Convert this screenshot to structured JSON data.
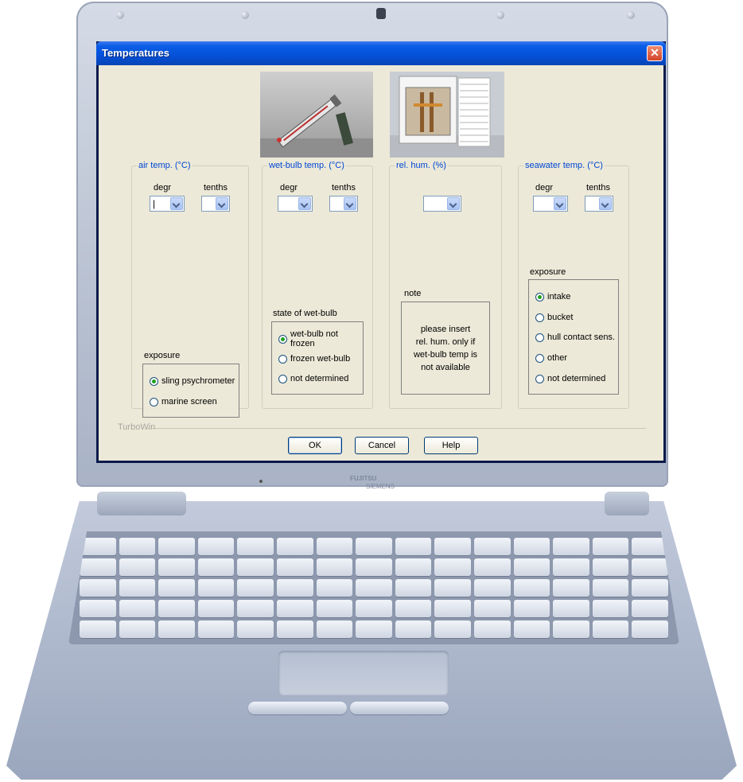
{
  "window": {
    "title": "Temperatures",
    "close_glyph": "✕"
  },
  "images": [
    {
      "icon": "sling-psychrometer-photo"
    },
    {
      "icon": "marine-screen-photo"
    }
  ],
  "groups": {
    "air": {
      "legend": "air temp. (°C)",
      "degr_label": "degr",
      "tenths_label": "tenths",
      "degr_value": "|",
      "tenths_value": "",
      "exposure_label": "exposure",
      "options": [
        {
          "label": "sling psychrometer",
          "selected": true
        },
        {
          "label": "marine screen",
          "selected": false
        }
      ]
    },
    "wetbulb": {
      "legend": "wet-bulb temp. (°C)",
      "degr_label": "degr",
      "tenths_label": "tenths",
      "degr_value": "",
      "tenths_value": "",
      "state_label": "state of wet-bulb",
      "options": [
        {
          "label": "wet-bulb not frozen",
          "selected": true
        },
        {
          "label": "frozen wet-bulb",
          "selected": false
        },
        {
          "label": "not determined",
          "selected": false
        }
      ]
    },
    "relhum": {
      "legend": "rel. hum. (%)",
      "value": "",
      "note_label": "note",
      "note_lines": [
        "please insert",
        "rel. hum. only if",
        "wet-bulb temp is",
        "not available"
      ]
    },
    "seawater": {
      "legend": "seawater temp. (°C)",
      "degr_label": "degr",
      "tenths_label": "tenths",
      "degr_value": "",
      "tenths_value": "",
      "exposure_label": "exposure",
      "options": [
        {
          "label": "intake",
          "selected": true
        },
        {
          "label": "bucket",
          "selected": false
        },
        {
          "label": "hull contact sens.",
          "selected": false
        },
        {
          "label": "other",
          "selected": false
        },
        {
          "label": "not determined",
          "selected": false
        }
      ]
    }
  },
  "footer": {
    "app_name": "TurboWin",
    "ok_label": "OK",
    "cancel_label": "Cancel",
    "help_label": "Help"
  },
  "laptop": {
    "brand_line1": "FUJITSU",
    "brand_line2": "SIEMENS"
  },
  "colors": {
    "titlebar": "#0551d8",
    "dialog_bg": "#ece9d8",
    "legend_text": "#0046d5",
    "radio_dot": "#21a121"
  }
}
